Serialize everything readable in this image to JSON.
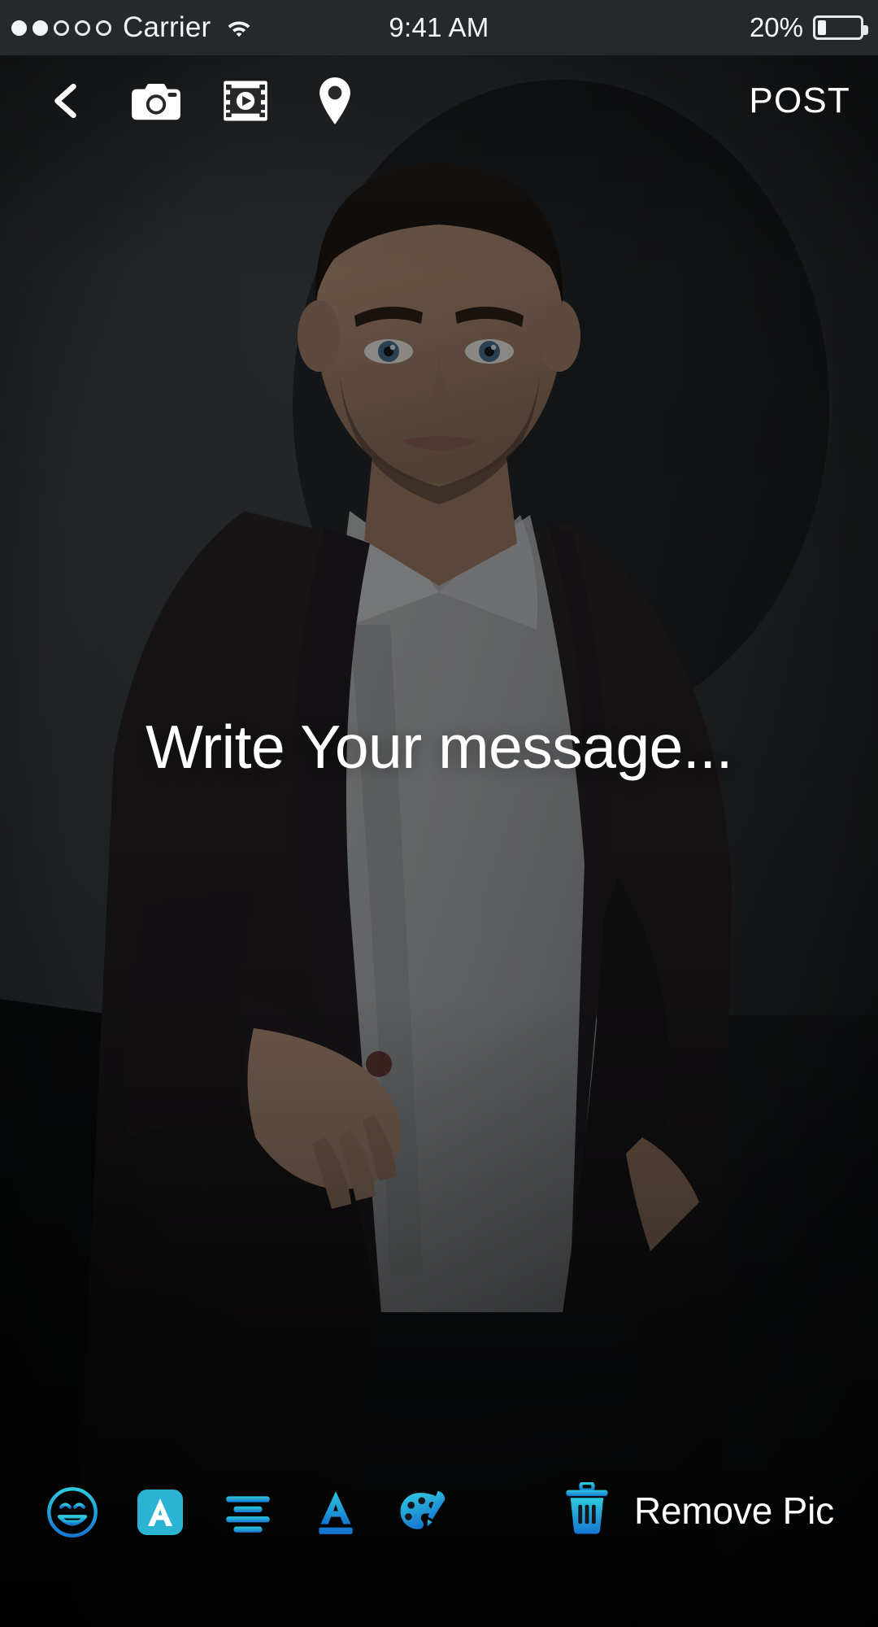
{
  "status_bar": {
    "signal_dots": {
      "total": 5,
      "filled": 2
    },
    "carrier": "Carrier",
    "wifi_icon": "wifi-icon",
    "time": "9:41 AM",
    "battery_percent_label": "20%",
    "battery_level": 20
  },
  "toolbar": {
    "back_icon": "back-chevron-icon",
    "camera_icon": "camera-icon",
    "video_icon": "film-video-icon",
    "location_icon": "location-pin-icon",
    "post_label": "POST"
  },
  "composer": {
    "message_placeholder": "Write Your message...",
    "message_value": ""
  },
  "bottom_bar": {
    "tools": [
      {
        "name": "emoji-icon",
        "label": "Emoji",
        "active": false
      },
      {
        "name": "font-style-icon",
        "label": "Font",
        "active": true
      },
      {
        "name": "text-align-icon",
        "label": "Align",
        "active": false
      },
      {
        "name": "text-color-icon",
        "label": "Text Color",
        "active": false
      },
      {
        "name": "palette-icon",
        "label": "Palette",
        "active": false
      }
    ],
    "remove_icon": "trash-icon",
    "remove_label": "Remove Pic"
  },
  "colors": {
    "accent_cyan": "#2ec4dd",
    "accent_blue": "#1577d2",
    "active_chip_bg": "#2bb3d4",
    "status_bar_bg": "#26292c",
    "text_white": "#ffffff"
  }
}
